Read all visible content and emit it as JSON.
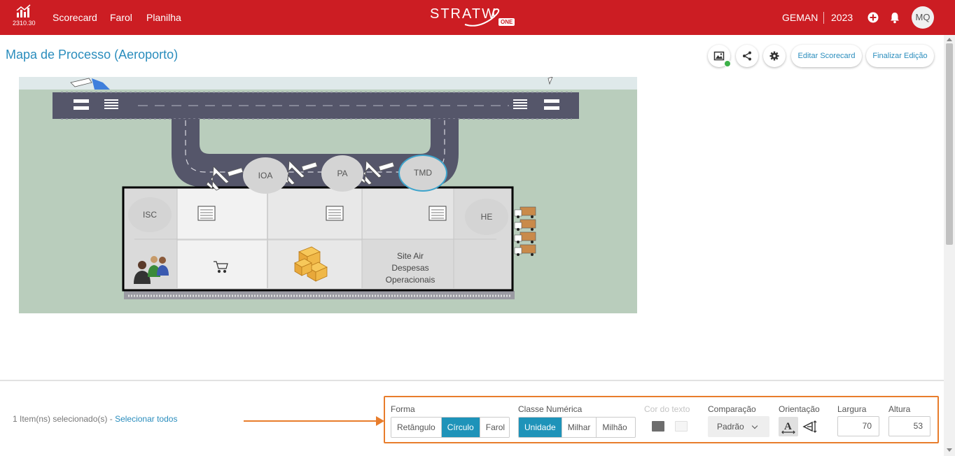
{
  "topbar": {
    "version": "2310.30",
    "nav": [
      "Scorecard",
      "Farol",
      "Planilha"
    ],
    "brand_word": "STRATW",
    "brand_badge": "ONE",
    "unit": "GEMAN",
    "year": "2023",
    "avatar_initials": "MQ",
    "color": "#cc1d23"
  },
  "page": {
    "title": "Mapa de Processo (Aeroporto)",
    "edit_scorecard": "Editar Scorecard",
    "finish_edit": "Finalizar Edição"
  },
  "map": {
    "shapes": {
      "ioa": "IOA",
      "pa": "PA",
      "tmd": "TMD",
      "isc": "ISC",
      "he": "HE"
    },
    "site_box": {
      "line1": "Site Air",
      "line2": "Despesas",
      "line3": "Operacionais"
    }
  },
  "bottom": {
    "selected_count": "1 Item(ns) selecionado(s)",
    "separator": " - ",
    "select_all": "Selecionar todos",
    "forma": {
      "label": "Forma",
      "options": [
        "Retângulo",
        "Círculo",
        "Farol"
      ],
      "selected": "Círculo"
    },
    "classe_numerica": {
      "label": "Classe Numérica",
      "options": [
        "Unidade",
        "Milhar",
        "Milhão"
      ],
      "selected": "Unidade"
    },
    "cor_do_texto": {
      "label": "Cor do texto",
      "colors": [
        "#6d6d6d",
        "#f5f5f5"
      ]
    },
    "comparacao": {
      "label": "Comparação",
      "value": "Padrão"
    },
    "orientacao": {
      "label": "Orientação"
    },
    "largura": {
      "label": "Largura",
      "value": "70"
    },
    "altura": {
      "label": "Altura",
      "value": "53"
    },
    "highlight_color": "#e87d2c",
    "accent_color": "#1e93b9"
  }
}
